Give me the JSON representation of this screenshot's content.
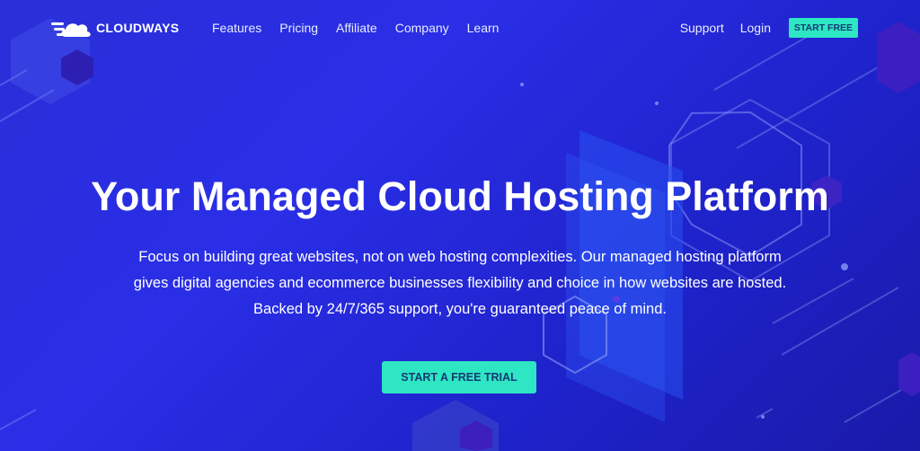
{
  "brand": {
    "name": "CLOUDWAYS",
    "logo_icon": "cloud-icon"
  },
  "nav": {
    "links": [
      "Features",
      "Pricing",
      "Affiliate",
      "Company",
      "Learn"
    ],
    "support": "Support",
    "login": "Login",
    "cta": "START FREE"
  },
  "hero": {
    "title": "Your Managed Cloud Hosting Platform",
    "lines": [
      "Focus on building great websites, not on web hosting complexities. Our managed hosting platform",
      "gives digital agencies and ecommerce businesses flexibility and choice in how websites are hosted.",
      "Backed by 24/7/365 support, you're guaranteed peace of mind."
    ],
    "cta": "START A FREE TRIAL"
  },
  "colors": {
    "background": "#2a2ee6",
    "accent": "#2ee6c4",
    "cta_text": "#153a72"
  }
}
